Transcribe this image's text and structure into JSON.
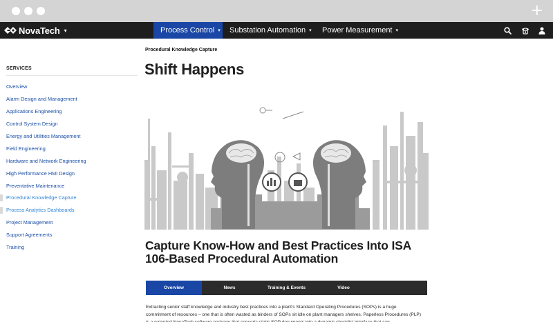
{
  "browser": {
    "new_tab_icon": "plus-icon"
  },
  "nav": {
    "logo_text": "NovaTech",
    "logo_icon": "novatech-logo-mark",
    "caret": "▾",
    "items": [
      {
        "label": "Process Control",
        "active": true
      },
      {
        "label": "Substation Automation",
        "active": false
      },
      {
        "label": "Power Measurement",
        "active": false
      }
    ],
    "icons": [
      "search-icon",
      "phone-icon",
      "user-icon"
    ],
    "active_color": "#1a47a6"
  },
  "sidebar": {
    "heading": "SERVICES",
    "items": [
      {
        "label": "Overview"
      },
      {
        "label": "Alarm Design and Management"
      },
      {
        "label": "Applications Engineering"
      },
      {
        "label": "Control System Design"
      },
      {
        "label": "Energy and Utilities Management"
      },
      {
        "label": "Field Engineering"
      },
      {
        "label": "Hardware and Network Engineering"
      },
      {
        "label": "High Performance HMI Design"
      },
      {
        "label": "Preventative Maintenance"
      },
      {
        "label": "Procedural Knowledge Capture",
        "current": true
      },
      {
        "label": "Process Analytics Dashboards"
      },
      {
        "label": "Project Management"
      },
      {
        "label": "Support Agreements"
      },
      {
        "label": "Training"
      }
    ]
  },
  "main": {
    "eyebrow": "Procedural Knowledge Capture",
    "title": "Shift Happens",
    "subhead": "Capture Know-How and Best Practices Into ISA 106-Based Procedural Automation",
    "tabs": [
      {
        "label": "Overview",
        "active": true
      },
      {
        "label": "News",
        "active": false
      },
      {
        "label": "Training & Events",
        "active": false
      },
      {
        "label": "Video",
        "active": false
      }
    ],
    "body": "Extracting senior staff knowledge and industry best practices into a plant's Standard Operating Procedures (SOPs) is a huge commitment of resources – one that is often wasted as binders of SOPs sit idle on plant managers shelves.  Paperless Procedures (PLP) is a patented NovaTech software package that converts static SOP documents into a dynamic checklist interface that can"
  }
}
